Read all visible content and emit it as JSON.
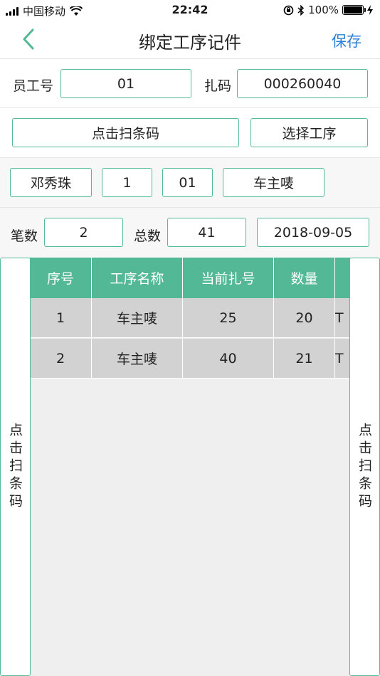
{
  "status": {
    "carrier": "中国移动",
    "time": "22:42",
    "battery": "100%"
  },
  "nav": {
    "title": "绑定工序记件",
    "save_label": "保存",
    "back_icon": "chevron-left-icon"
  },
  "form": {
    "employee_label": "员工号",
    "employee_value": "01",
    "code_label": "扎码",
    "code_value": "000260040",
    "scan_button": "点击扫条码",
    "select_process_button": "选择工序",
    "name": "邓秀珠",
    "field_one": "1",
    "field_two": "01",
    "process_name": "车主唛",
    "count_label": "笔数",
    "count_value": "2",
    "total_label": "总数",
    "total_value": "41",
    "date": "2018-09-05"
  },
  "table": {
    "headers": [
      "序号",
      "工序名称",
      "当前扎号",
      "数量",
      ""
    ],
    "rows": [
      [
        "1",
        "车主唛",
        "25",
        "20",
        "T"
      ],
      [
        "2",
        "车主唛",
        "40",
        "21",
        "T"
      ]
    ]
  },
  "side": {
    "left_label": "点击扫条码",
    "right_label": "点击扫条码"
  },
  "colors": {
    "accent": "#52b896",
    "link": "#2f7fd8"
  }
}
